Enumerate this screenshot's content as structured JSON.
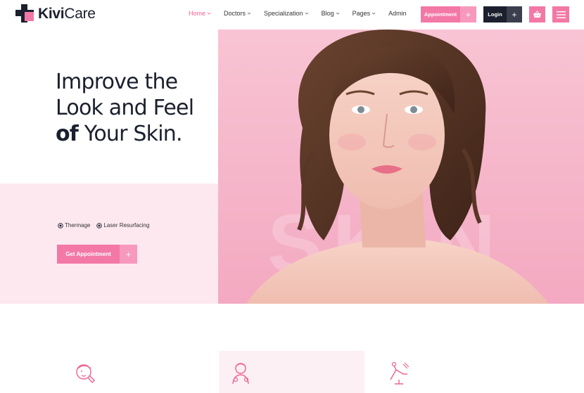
{
  "brand": {
    "name_bold": "Kivi",
    "name_rest": "Care",
    "color": "#f378a6",
    "dark": "#1b1f2e"
  },
  "nav": {
    "items": [
      {
        "label": "Home",
        "dropdown": true,
        "active": true
      },
      {
        "label": "Doctors",
        "dropdown": true,
        "active": false
      },
      {
        "label": "Specialization",
        "dropdown": true,
        "active": false
      },
      {
        "label": "Blog",
        "dropdown": true,
        "active": false
      },
      {
        "label": "Pages",
        "dropdown": true,
        "active": false
      },
      {
        "label": "Admin",
        "dropdown": false,
        "active": false
      }
    ]
  },
  "header_actions": {
    "appointment_label": "Appointment",
    "login_label": "Login",
    "plus": "+",
    "cart_icon": "basket-icon",
    "menu_icon": "hamburger-menu-icon"
  },
  "hero": {
    "title_line1": "Improve the",
    "title_line2": "Look and Feel",
    "title_line3_bold": "of",
    "title_line3_rest": " Your Skin.",
    "tags": [
      "Thermage",
      "Laser Resurfacing"
    ],
    "cta_label": "Get Appointment",
    "cta_plus": "+",
    "background_watermark": "SKIN",
    "image": "woman-portrait-photo"
  },
  "features": {
    "icons": [
      "face-care-icon",
      "doctor-icon",
      "dental-chair-icon"
    ]
  }
}
